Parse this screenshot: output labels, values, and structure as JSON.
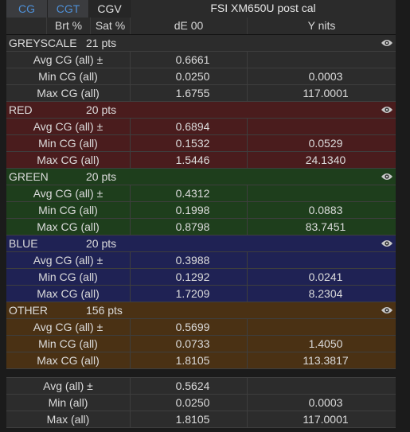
{
  "tabs": [
    {
      "label": "CG"
    },
    {
      "label": "CGT"
    },
    {
      "label": "CGV"
    }
  ],
  "title": "FSI XM650U post cal",
  "columns": {
    "brt": "Brt %",
    "sat": "Sat %",
    "de": "dE 00",
    "y": "Y nits"
  },
  "sections": [
    {
      "name": "GREYSCALE",
      "pts": "21 pts",
      "bg": "#2c2c2c",
      "rows": [
        {
          "label": "Avg CG (all) ±",
          "de": "0.6661",
          "y": ""
        },
        {
          "label": "Min CG (all)",
          "de": "0.0250",
          "y": "0.0003"
        },
        {
          "label": "Max CG (all)",
          "de": "1.6755",
          "y": "117.0001"
        }
      ]
    },
    {
      "name": "RED",
      "pts": "20 pts",
      "bg": "#4a1c1d",
      "rows": [
        {
          "label": "Avg CG (all) ±",
          "de": "0.6894",
          "y": ""
        },
        {
          "label": "Min CG (all)",
          "de": "0.1532",
          "y": "0.0529"
        },
        {
          "label": "Max CG (all)",
          "de": "1.5446",
          "y": "24.1340"
        }
      ]
    },
    {
      "name": "GREEN",
      "pts": "20 pts",
      "bg": "#1e3e1c",
      "rows": [
        {
          "label": "Avg CG (all) ±",
          "de": "0.4312",
          "y": ""
        },
        {
          "label": "Min CG (all)",
          "de": "0.1998",
          "y": "0.0883"
        },
        {
          "label": "Max CG (all)",
          "de": "0.8798",
          "y": "83.7451"
        }
      ]
    },
    {
      "name": "BLUE",
      "pts": "20 pts",
      "bg": "#1f2254",
      "rows": [
        {
          "label": "Avg CG (all) ±",
          "de": "0.3988",
          "y": ""
        },
        {
          "label": "Min CG (all)",
          "de": "0.1292",
          "y": "0.0241"
        },
        {
          "label": "Max CG (all)",
          "de": "1.7209",
          "y": "8.2304"
        }
      ]
    },
    {
      "name": "OTHER",
      "pts": "156 pts",
      "bg": "#4a3114",
      "rows": [
        {
          "label": "Avg CG (all) ±",
          "de": "0.5699",
          "y": ""
        },
        {
          "label": "Min CG (all)",
          "de": "0.0733",
          "y": "1.4050"
        },
        {
          "label": "Max CG (all)",
          "de": "1.8105",
          "y": "113.3817"
        }
      ]
    }
  ],
  "totals": [
    {
      "label": "Avg (all) ±",
      "de": "0.5624",
      "y": ""
    },
    {
      "label": "Min (all)",
      "de": "0.0250",
      "y": "0.0003"
    },
    {
      "label": "Max (all)",
      "de": "1.8105",
      "y": "117.0001"
    }
  ],
  "totals_bg": "#2c2c2c"
}
